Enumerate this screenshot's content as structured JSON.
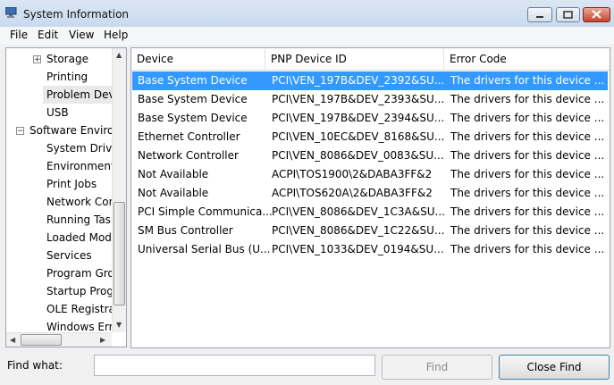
{
  "window": {
    "title": "System Information"
  },
  "menu": [
    "File",
    "Edit",
    "View",
    "Help"
  ],
  "tree": [
    {
      "label": "Storage",
      "level": 2,
      "expander": "+"
    },
    {
      "label": "Printing",
      "level": 2
    },
    {
      "label": "Problem Devices",
      "level": 2,
      "selected": true
    },
    {
      "label": "USB",
      "level": 2
    },
    {
      "label": "Software Environment",
      "level": 1,
      "expander": "-"
    },
    {
      "label": "System Drivers",
      "level": 2
    },
    {
      "label": "Environment Variables",
      "level": 2
    },
    {
      "label": "Print Jobs",
      "level": 2
    },
    {
      "label": "Network Connections",
      "level": 2
    },
    {
      "label": "Running Tasks",
      "level": 2
    },
    {
      "label": "Loaded Modules",
      "level": 2
    },
    {
      "label": "Services",
      "level": 2
    },
    {
      "label": "Program Groups",
      "level": 2
    },
    {
      "label": "Startup Programs",
      "level": 2
    },
    {
      "label": "OLE Registration",
      "level": 2
    },
    {
      "label": "Windows Error Reporting",
      "level": 2
    }
  ],
  "list": {
    "columns": [
      "Device",
      "PNP Device ID",
      "Error Code"
    ],
    "rows": [
      {
        "device": "Base System Device",
        "pnp": "PCI\\VEN_197B&DEV_2392&SU...",
        "error": "The drivers for this device ...",
        "selected": true
      },
      {
        "device": "Base System Device",
        "pnp": "PCI\\VEN_197B&DEV_2393&SU...",
        "error": "The drivers for this device ..."
      },
      {
        "device": "Base System Device",
        "pnp": "PCI\\VEN_197B&DEV_2394&SU...",
        "error": "The drivers for this device ..."
      },
      {
        "device": "Ethernet Controller",
        "pnp": "PCI\\VEN_10EC&DEV_8168&SU...",
        "error": "The drivers for this device ..."
      },
      {
        "device": "Network Controller",
        "pnp": "PCI\\VEN_8086&DEV_0083&SU...",
        "error": "The drivers for this device ..."
      },
      {
        "device": "Not Available",
        "pnp": "ACPI\\TOS1900\\2&DABA3FF&2",
        "error": "The drivers for this device ..."
      },
      {
        "device": "Not Available",
        "pnp": "ACPI\\TOS620A\\2&DABA3FF&2",
        "error": "The drivers for this device ..."
      },
      {
        "device": "PCI Simple Communica...",
        "pnp": "PCI\\VEN_8086&DEV_1C3A&SU...",
        "error": "The drivers for this device ..."
      },
      {
        "device": "SM Bus Controller",
        "pnp": "PCI\\VEN_8086&DEV_1C22&SU...",
        "error": "The drivers for this device ..."
      },
      {
        "device": "Universal Serial Bus (U...",
        "pnp": "PCI\\VEN_1033&DEV_0194&SU...",
        "error": "The drivers for this device ..."
      }
    ]
  },
  "find": {
    "label": "Find what:",
    "value": "",
    "find_button": "Find",
    "close_button": "Close Find"
  },
  "colors": {
    "selection": "#3399ff",
    "title_gradient": "#c9d9ee",
    "close_button": "#c8432c"
  }
}
